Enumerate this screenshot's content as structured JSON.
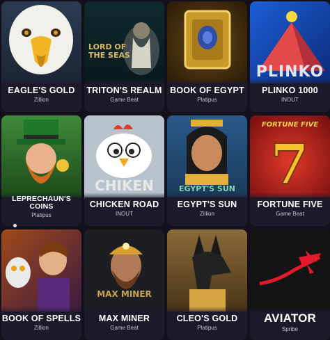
{
  "games": [
    {
      "title": "EAGLE'S GOLD",
      "provider": "Zillion",
      "art": "eagle"
    },
    {
      "title": "TRITON'S REALM",
      "provider": "Game Beat",
      "art": "triton",
      "art_text": "LORD OF THE SEAS"
    },
    {
      "title": "BOOK OF EGYPT",
      "provider": "Platipus",
      "art": "book-egypt"
    },
    {
      "title": "PLINKO 1000",
      "provider": "INOUT",
      "art": "plinko",
      "art_text": "PLINKO"
    },
    {
      "title": "LEPRECHAUN'S COINS",
      "provider": "Platipus",
      "art": "leprechaun"
    },
    {
      "title": "CHICKEN ROAD",
      "provider": "INOUT",
      "art": "chicken",
      "art_text": "CHIKEN"
    },
    {
      "title": "EGYPT'S SUN",
      "provider": "Zillion",
      "art": "egypt-sun",
      "art_text": "EGYPT'S SUN"
    },
    {
      "title": "FORTUNE FIVE",
      "provider": "Game Beat",
      "art": "fortune-five",
      "art_text": "FORTUNE FIVE"
    },
    {
      "title": "BOOK OF SPELLS",
      "provider": "Zillion",
      "art": "book-spells"
    },
    {
      "title": "MAX MINER",
      "provider": "Game Beat",
      "art": "max-miner",
      "art_text": "MAX MINER"
    },
    {
      "title": "CLEO'S GOLD",
      "provider": "Platipus",
      "art": "anubis"
    },
    {
      "title": "AVIATOR",
      "provider": "Spribe",
      "art": "aviator"
    }
  ],
  "colors": {
    "background": "#14101c",
    "card": "#1f1a2b",
    "title": "#ffffff",
    "provider": "#c8c4d4"
  }
}
